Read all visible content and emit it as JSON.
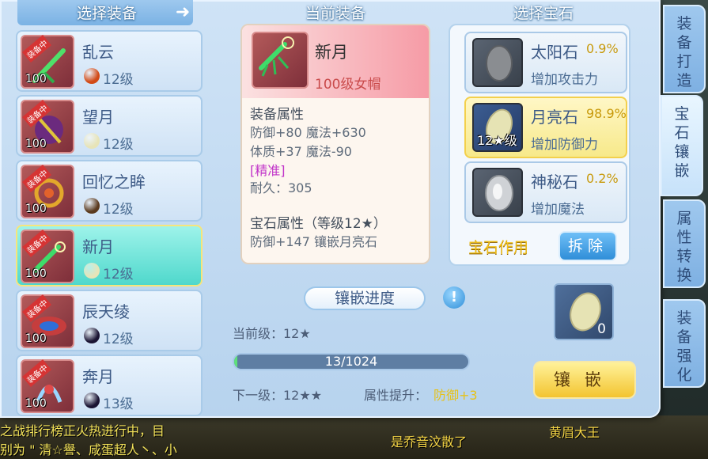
{
  "left": {
    "title": "选择装备",
    "items": [
      {
        "tag": "装备中",
        "level": "100",
        "name": "乱云",
        "gem_level": "12级",
        "gem_color": "#d24a16",
        "selected": false
      },
      {
        "tag": "装备中",
        "level": "100",
        "name": "望月",
        "gem_level": "12级",
        "gem_color": "#e7e4b8",
        "selected": false
      },
      {
        "tag": "装备中",
        "level": "100",
        "name": "回忆之眸",
        "gem_level": "12级",
        "gem_color": "#5b3a1e",
        "selected": false
      },
      {
        "tag": "装备中",
        "level": "100",
        "name": "新月",
        "gem_level": "12级",
        "gem_color": "#e7e4b8",
        "selected": true
      },
      {
        "tag": "装备中",
        "level": "100",
        "name": "辰天绫",
        "gem_level": "12级",
        "gem_color": "#1b1433",
        "selected": false
      },
      {
        "tag": "装备中",
        "level": "100",
        "name": "奔月",
        "gem_level": "13级",
        "gem_color": "#1b1433",
        "selected": false
      }
    ]
  },
  "middle": {
    "title": "当前装备",
    "name": "新月",
    "subtitle": "100级女帽",
    "attr_title": "装备属性",
    "attr_line1": "防御+80 魔法+630",
    "attr_line2": "体质+37 魔法-90",
    "quality": "[精准]",
    "durability": "耐久：305",
    "gem_attr_title": "宝石属性（等级12★）",
    "gem_attr_line": "防御+147 镶嵌月亮石",
    "progress_title": "镶嵌进度",
    "help": "!",
    "current_level": "当前级：12★",
    "progress_text": "13/1024",
    "progress_fraction": 0.0127,
    "next_level": "下一级：12★★",
    "attr_bonus_label": "属性提升：",
    "attr_bonus_value": "防御+3"
  },
  "right": {
    "title": "选择宝石",
    "gems": [
      {
        "name": "太阳石",
        "pct": "0.9%",
        "desc": "增加攻击力",
        "level": "",
        "selected": false
      },
      {
        "name": "月亮石",
        "pct": "98.9%",
        "desc": "增加防御力",
        "level": "12★级",
        "selected": true
      },
      {
        "name": "神秘石",
        "pct": "0.2%",
        "desc": "增加魔法",
        "level": "",
        "selected": false
      }
    ],
    "effect_label": "宝石作用",
    "remove_label": "拆除",
    "slot_count": "0",
    "inlay_label": "镶嵌"
  },
  "tabs": [
    {
      "label": "装备打造",
      "active": false
    },
    {
      "label": "宝石镶嵌",
      "active": true
    },
    {
      "label": "属性转换",
      "active": false
    },
    {
      "label": "装备强化",
      "active": false
    }
  ],
  "bottom": {
    "scroll_line1": "之战排行榜正火热进行中，目",
    "scroll_line2": "别为 \" 清☆譽、咸蛋超人丶、小",
    "center_text": "是乔音汶散了",
    "right_text": "黄眉大王"
  }
}
